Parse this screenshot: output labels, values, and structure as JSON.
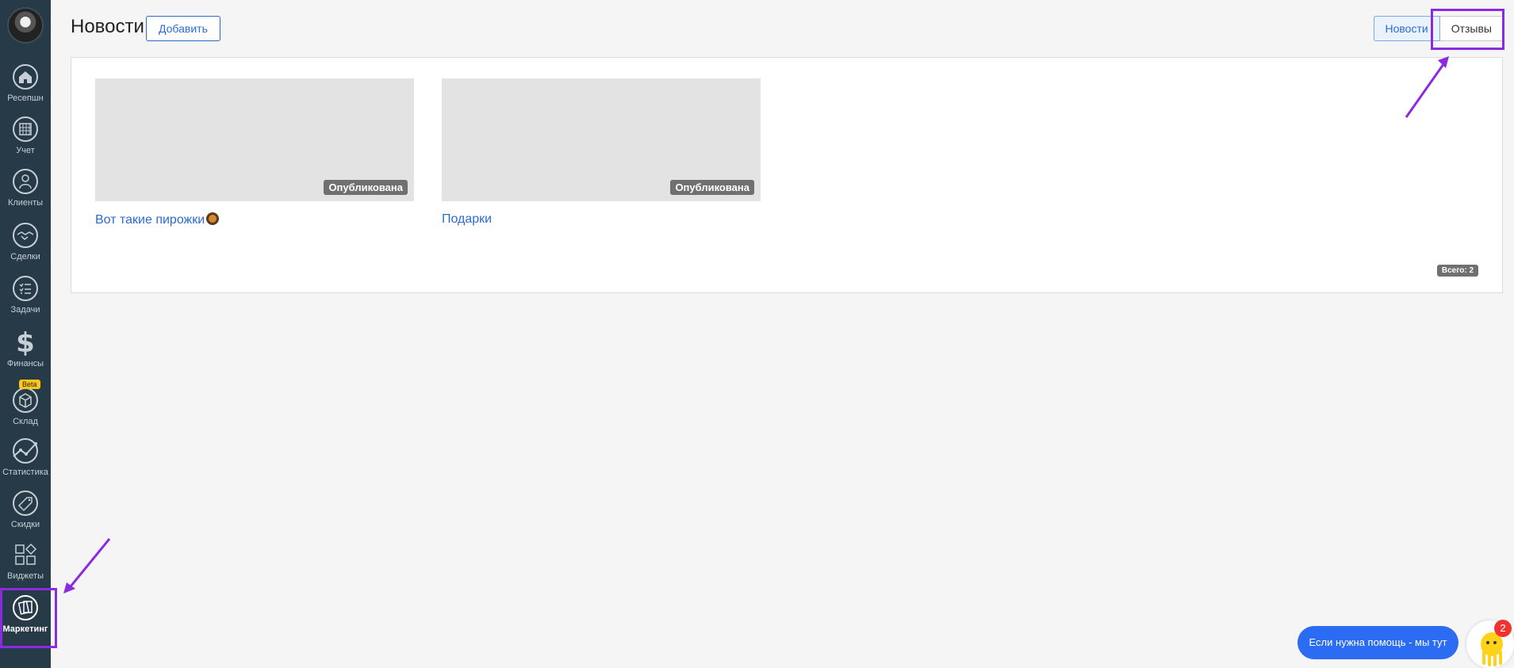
{
  "header": {
    "title": "Новости",
    "add_label": "Добавить"
  },
  "tabs": [
    {
      "label": "Новости",
      "active": true
    },
    {
      "label": "Отзывы",
      "active": false
    }
  ],
  "sidebar": {
    "items": [
      {
        "label": "Ресепшн",
        "icon": "home-icon"
      },
      {
        "label": "Учет",
        "icon": "calendar-icon"
      },
      {
        "label": "Клиенты",
        "icon": "user-icon"
      },
      {
        "label": "Сделки",
        "icon": "handshake-icon"
      },
      {
        "label": "Задачи",
        "icon": "checklist-icon"
      },
      {
        "label": "Финансы",
        "icon": "dollar-icon"
      },
      {
        "label": "Склад",
        "icon": "box-icon",
        "badge": "Beta"
      },
      {
        "label": "Статистика",
        "icon": "chart-line-icon"
      },
      {
        "label": "Скидки",
        "icon": "sale-tag-icon"
      },
      {
        "label": "Виджеты",
        "icon": "widgets-icon"
      },
      {
        "label": "Маркетинг",
        "icon": "marketing-icon",
        "active": true
      }
    ]
  },
  "news": [
    {
      "title": "Вот такие пирожки",
      "status": "Опубликована",
      "emoji": "donut-emoji"
    },
    {
      "title": "Подарки",
      "status": "Опубликована"
    }
  ],
  "total_label": "Всего: 2",
  "help": {
    "label": "Если нужна помощь - мы тут",
    "notifications": "2"
  },
  "colors": {
    "sidebar": "#263a48",
    "accent": "#2b6cd3",
    "highlight": "#8a2be2",
    "help_button": "#2b6cf3"
  }
}
